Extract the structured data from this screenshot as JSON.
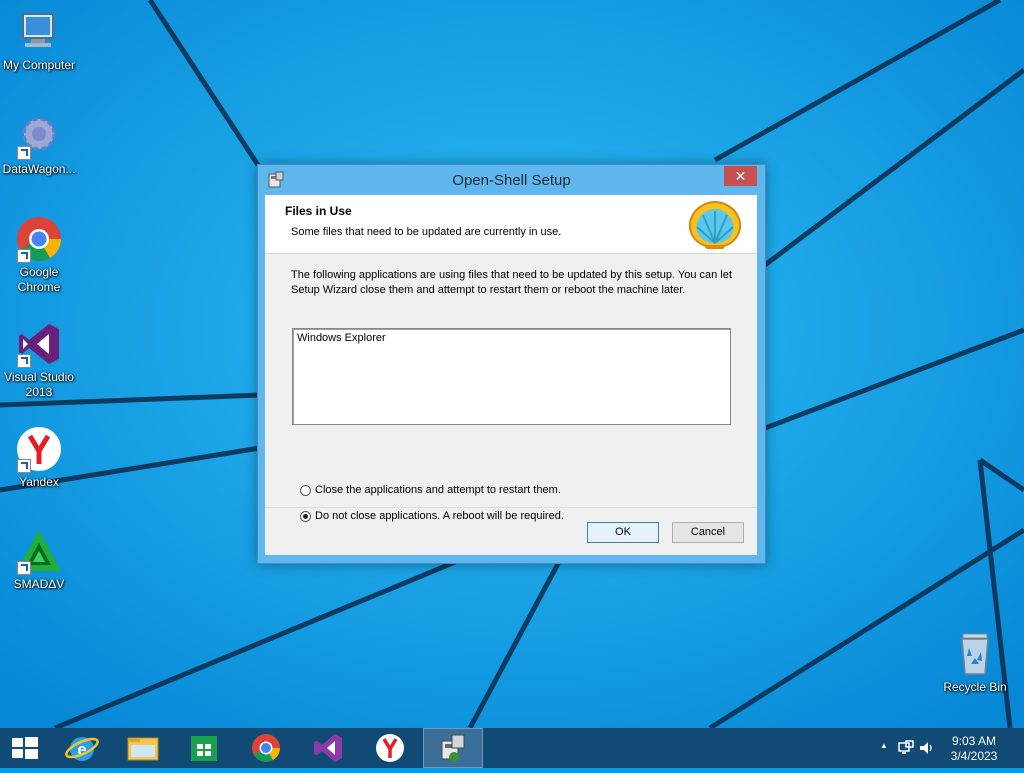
{
  "desktop": {
    "icons": [
      {
        "label": "My Computer"
      },
      {
        "label": "DataWagon..."
      },
      {
        "label": "Google Chrome"
      },
      {
        "label": "Visual Studio 2013"
      },
      {
        "label": "Yandex"
      },
      {
        "label": "SMADΔV"
      },
      {
        "label": "Recycle Bin"
      }
    ]
  },
  "dialog": {
    "title": "Open-Shell Setup",
    "close_label": "✕",
    "header_title": "Files in Use",
    "header_subtitle": "Some files that need to be updated are currently in use.",
    "description": "The following applications are using files that need to be updated by this setup. You can let Setup Wizard close them and attempt to restart them or reboot the machine later.",
    "app_list": [
      "Windows Explorer"
    ],
    "options": {
      "close_apps": "Close the applications and attempt to restart them.",
      "no_close": "Do not close applications. A reboot will be required."
    },
    "selected_option": "no_close",
    "ok_label": "OK",
    "cancel_label": "Cancel"
  },
  "taskbar": {
    "time": "9:03 AM",
    "date": "3/4/2023",
    "tray_arrow": "▲"
  },
  "colors": {
    "desktop": "#0a9be3",
    "taskbar": "#114a75",
    "close_button": "#c75050"
  }
}
